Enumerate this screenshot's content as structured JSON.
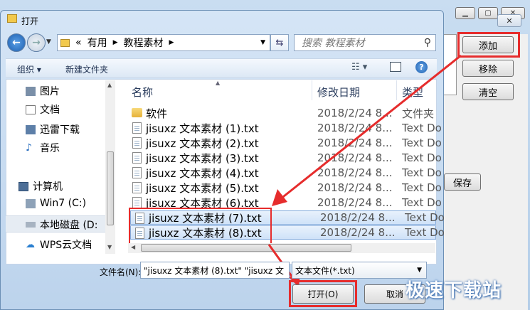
{
  "dialog": {
    "title": "打开",
    "close_glyph": "✕",
    "address": {
      "prefix": "«",
      "crumbs": [
        "有用",
        "教程素材"
      ]
    },
    "search_placeholder": "搜索 教程素材",
    "toolbar": {
      "organize": "组织 ▾",
      "new_folder": "新建文件夹"
    },
    "nav": [
      {
        "label": "图片",
        "icon": "pictures-icon"
      },
      {
        "label": "文档",
        "icon": "documents-icon"
      },
      {
        "label": "迅雷下载",
        "icon": "download-icon"
      },
      {
        "label": "音乐",
        "icon": "music-icon"
      },
      {
        "label": "计算机",
        "icon": "computer-icon"
      },
      {
        "label": "Win7 (C:)",
        "icon": "drive-icon"
      },
      {
        "label": "本地磁盘 (D:",
        "icon": "drive-icon"
      },
      {
        "label": "WPS云文档",
        "icon": "cloud-icon"
      }
    ],
    "columns": {
      "name": "名称",
      "date": "修改日期",
      "type": "类型"
    },
    "files": [
      {
        "name": "软件",
        "date": "2018/2/24 8...",
        "type": "文件夹",
        "kind": "folder"
      },
      {
        "name": "jisuxz 文本素材 (1).txt",
        "date": "2018/2/24 8...",
        "type": "Text Do",
        "kind": "txt"
      },
      {
        "name": "jisuxz 文本素材 (2).txt",
        "date": "2018/2/24 8...",
        "type": "Text Do",
        "kind": "txt"
      },
      {
        "name": "jisuxz 文本素材 (3).txt",
        "date": "2018/2/24 8...",
        "type": "Text Do",
        "kind": "txt"
      },
      {
        "name": "jisuxz 文本素材 (4).txt",
        "date": "2018/2/24 8...",
        "type": "Text Do",
        "kind": "txt"
      },
      {
        "name": "jisuxz 文本素材 (5).txt",
        "date": "2018/2/24 8...",
        "type": "Text Do",
        "kind": "txt"
      },
      {
        "name": "jisuxz 文本素材 (6).txt",
        "date": "2018/2/24 8...",
        "type": "Text Do",
        "kind": "txt"
      },
      {
        "name": "jisuxz 文本素材 (7).txt",
        "date": "2018/2/24 8...",
        "type": "Text Do",
        "kind": "txt",
        "selected": true
      },
      {
        "name": "jisuxz 文本素材 (8).txt",
        "date": "2018/2/24 8...",
        "type": "Text Do",
        "kind": "txt",
        "selected": true
      }
    ],
    "filename_label": "文件名(N):",
    "filename_value": "\"jisuxz 文本素材 (8).txt\" \"jisuxz 文",
    "filter_value": "文本文件(*.txt)",
    "open_label": "打开(O)",
    "cancel_label": "取消"
  },
  "app": {
    "add_label": "添加",
    "remove_label": "移除",
    "clear_label": "清空",
    "save_label": "保存"
  },
  "watermark": "极速下载站",
  "colors": {
    "highlight": "#e62c2c",
    "accent": "#3d6fb0"
  }
}
